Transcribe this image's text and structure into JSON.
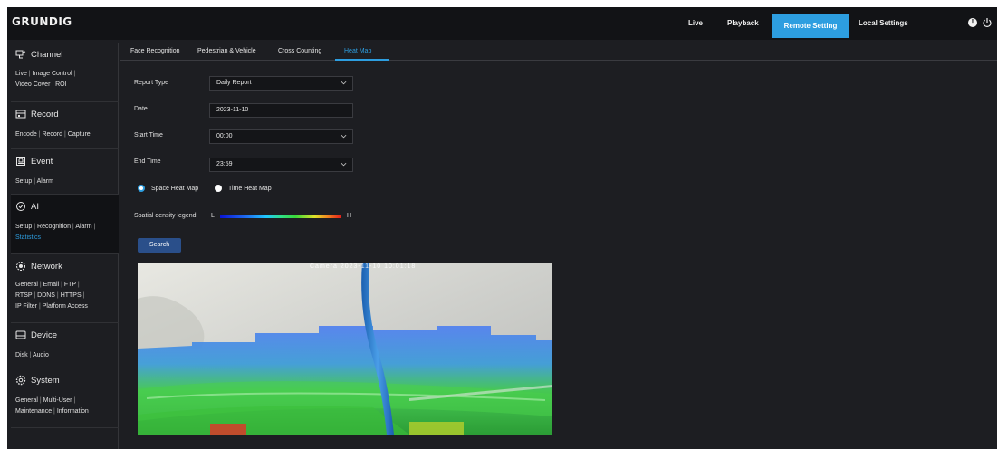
{
  "app": {
    "brand": "GRUNDIG"
  },
  "topnav": [
    {
      "label": "Live"
    },
    {
      "label": "Playback"
    },
    {
      "label": "Remote Setting",
      "active": true
    },
    {
      "label": "Local Settings"
    }
  ],
  "topicons": {
    "info": "!"
  },
  "sidebar": [
    {
      "title": "Channel",
      "icon": "channel-icon",
      "links": [
        "Live",
        "Image Control",
        "Video Cover",
        "ROI"
      ]
    },
    {
      "title": "Record",
      "icon": "record-icon",
      "links": [
        "Encode",
        "Record",
        "Capture"
      ]
    },
    {
      "title": "Event",
      "icon": "event-icon",
      "links": [
        "Setup",
        "Alarm"
      ]
    },
    {
      "title": "AI",
      "icon": "ai-icon",
      "links": [
        "Setup",
        "Recognition",
        "Alarm",
        "Statistics"
      ],
      "active": true,
      "active_link": "Statistics"
    },
    {
      "title": "Network",
      "icon": "network-icon",
      "links": [
        "General",
        "Email",
        "FTP",
        "RTSP",
        "DDNS",
        "HTTPS",
        "IP Filter",
        "Platform Access"
      ]
    },
    {
      "title": "Device",
      "icon": "device-icon",
      "links": [
        "Disk",
        "Audio"
      ]
    },
    {
      "title": "System",
      "icon": "system-icon",
      "links": [
        "General",
        "Multi-User",
        "Maintenance",
        "Information"
      ]
    }
  ],
  "tabs": [
    {
      "label": "Face Recognition"
    },
    {
      "label": "Pedestrian & Vehicle"
    },
    {
      "label": "Cross Counting"
    },
    {
      "label": "Heat Map",
      "active": true
    }
  ],
  "form": {
    "report_type": {
      "label": "Report Type",
      "value": "Daily Report"
    },
    "date": {
      "label": "Date",
      "value": "2023-11-10"
    },
    "start_time": {
      "label": "Start Time",
      "value": "00:00"
    },
    "end_time": {
      "label": "End Time",
      "value": "23:59"
    },
    "radios": [
      {
        "label": "Space Heat Map",
        "selected": true
      },
      {
        "label": "Time Heat Map",
        "selected": false
      }
    ],
    "legend": {
      "label": "Spatial density legend",
      "low": "L",
      "high": "H"
    },
    "search_label": "Search"
  },
  "video": {
    "osd": "Camera  2023-11-10 10:01:18"
  },
  "colors": {
    "accent": "#2d9ee0",
    "button": "#2a4f8a",
    "background": "#1d1e22",
    "topbar": "#121316"
  }
}
